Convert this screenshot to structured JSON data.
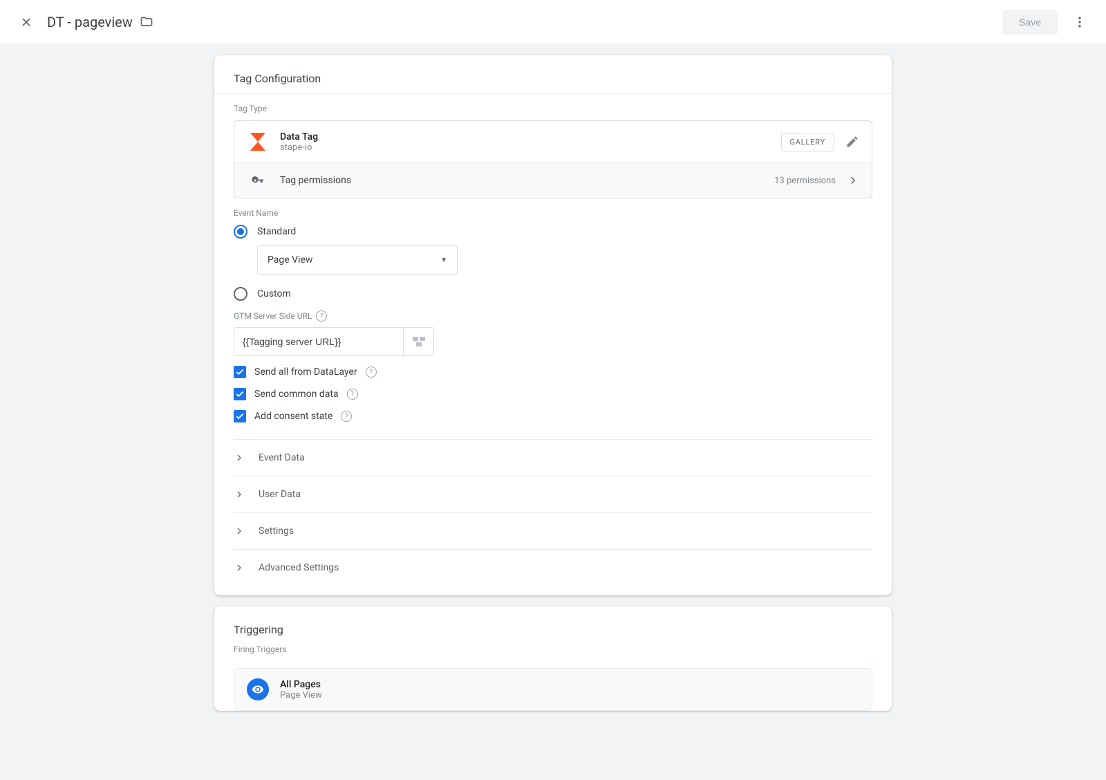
{
  "header": {
    "title": "DT - pageview",
    "save_label": "Save"
  },
  "config": {
    "card_title": "Tag Configuration",
    "tag_type_label": "Tag Type",
    "tag": {
      "name": "Data Tag",
      "vendor": "stape-io",
      "gallery_label": "GALLERY"
    },
    "perm": {
      "label": "Tag permissions",
      "count": "13 permissions"
    },
    "event_name_label": "Event Name",
    "radio_standard": "Standard",
    "radio_custom": "Custom",
    "event_select": "Page View",
    "url_label": "GTM Server Side URL",
    "url_value": "{{Tagging server URL}}",
    "checks": {
      "datalayer": "Send all from DataLayer",
      "common": "Send common data",
      "consent": "Add consent state"
    },
    "expand": {
      "event_data": "Event Data",
      "user_data": "User Data",
      "settings": "Settings",
      "adv": "Advanced Settings"
    }
  },
  "triggering": {
    "card_title": "Triggering",
    "section_label": "Firing Triggers",
    "trigger": {
      "name": "All Pages",
      "type": "Page View"
    }
  }
}
